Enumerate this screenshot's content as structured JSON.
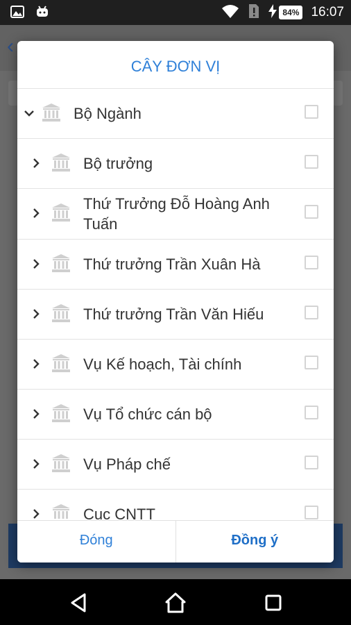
{
  "status_bar": {
    "time": "16:07",
    "battery": "84%",
    "icons": [
      "image-icon",
      "android-icon",
      "wifi-icon",
      "sim-alert-icon",
      "charging-icon"
    ]
  },
  "dialog": {
    "title": "CÂY ĐƠN VỊ",
    "root": {
      "label": "Bộ Ngành",
      "expanded": true,
      "checked": false
    },
    "items": [
      {
        "label": "Bộ trưởng",
        "checked": false
      },
      {
        "label": "Thứ Trưởng Đỗ Hoàng Anh Tuấn",
        "checked": false
      },
      {
        "label": "Thứ trưởng Trần Xuân Hà",
        "checked": false
      },
      {
        "label": "Thứ trưởng Trần Văn Hiếu",
        "checked": false
      },
      {
        "label": "Vụ Kế hoạch, Tài chính",
        "checked": false
      },
      {
        "label": "Vụ Tổ chức cán bộ",
        "checked": false
      },
      {
        "label": "Vụ Pháp chế",
        "checked": false
      },
      {
        "label": "Cục CNTT",
        "checked": false
      }
    ],
    "buttons": {
      "cancel": "Đóng",
      "ok": "Đồng ý"
    }
  },
  "colors": {
    "accent": "#2f80d8",
    "status_bar": "#1f1f1f",
    "scrim": "#6a6a6a",
    "app_bottom_bar": "#1e3b63"
  }
}
